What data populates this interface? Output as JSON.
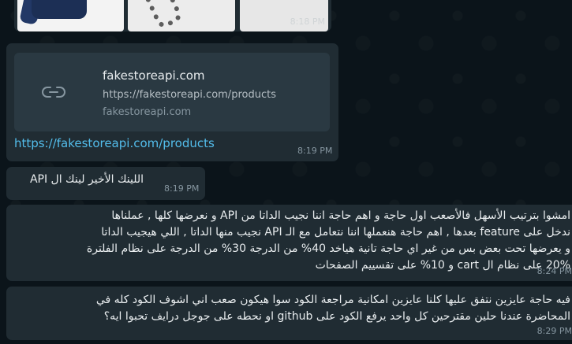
{
  "messages": {
    "image_time": "8:18 PM",
    "link": {
      "title": "fakestoreapi.com",
      "url": "https://fakestoreapi.com/products",
      "domain": "fakestoreapi.com",
      "anchor": "https://fakestoreapi.com/products",
      "time": "8:19 PM",
      "icon": "link-icon"
    },
    "api": {
      "text": "اللينك الأخير لينك ال API",
      "time": "8:19 PM"
    },
    "msg1": {
      "lines": [
        "امشوا بترتيب الأسهل فالأصعب اول حاجة و اهم حاجة اننا نجيب الداتا من API و نعرضها كلها , عملناها",
        "ندخل على feature بعدها , اهم حاجة هنعملها اننا نتعامل مع الـ API نجيب منها الداتا , اللي هيجيب الداتا",
        "و يعرضها تحت بعض بس من غير اي حاجة تانية هياخد 40% من الدرجة 30% من الدرجة على نظام الفلترة",
        "20% على نظام ال cart و 10% على تقسييم الصفحات"
      ],
      "time": "8:24 PM"
    },
    "msg2": {
      "lines": [
        "فيه حاجة عايزين نتفق عليها كلنا عايزين امكانية مراجعة الكود سوا هيكون صعب اني اشوف الكود كله في",
        "المحاضرة عندنا حلين مقترحين كل واحد يرفع الكود على github او نحطه على جوجل درايف تحبوا ايه؟"
      ],
      "time": "8:29 PM"
    }
  },
  "colors": {
    "background": "#0b141a",
    "bubble": "#202c33",
    "link": "#53bdeb",
    "timestamp": "#8696a0"
  }
}
